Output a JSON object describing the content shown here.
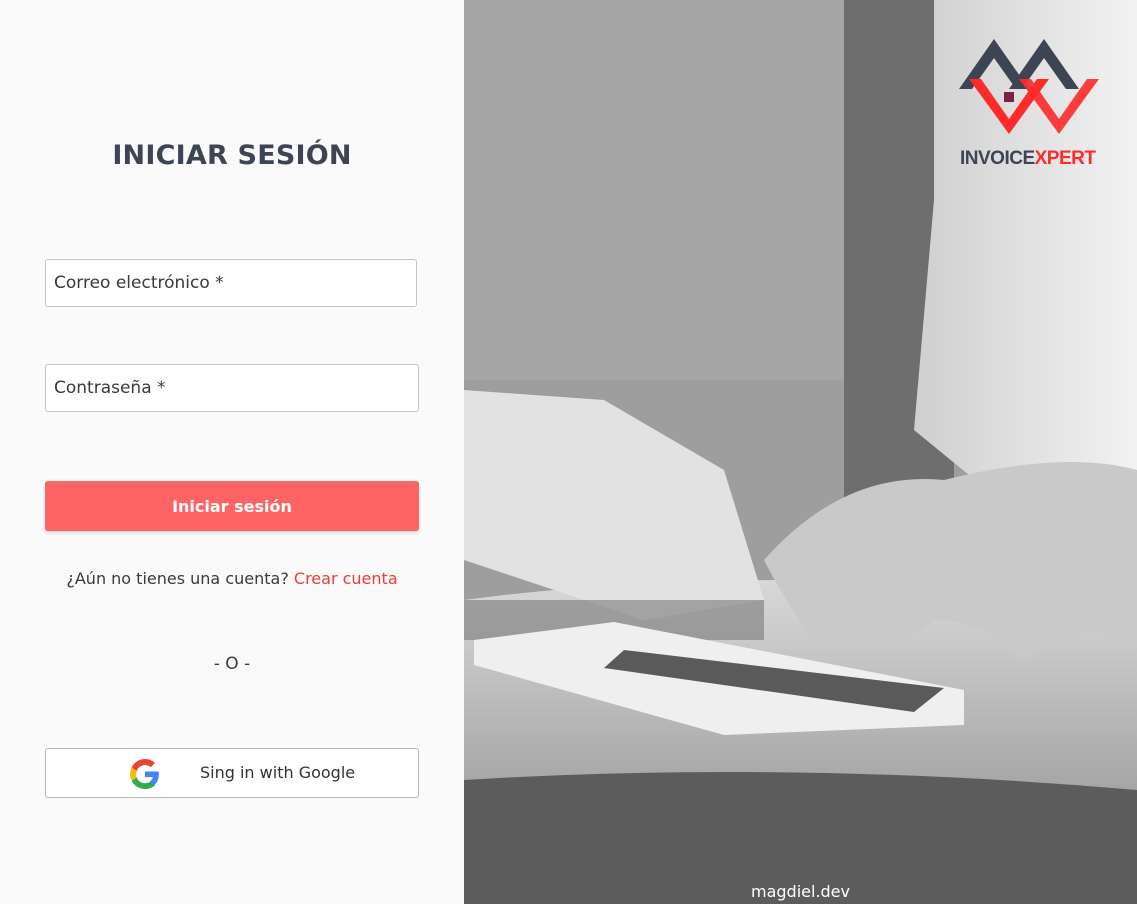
{
  "login": {
    "title": "INICIAR SESIÓN",
    "email_label": "Correo electrónico *",
    "password_label": "Contraseña *",
    "submit_label": "Iniciar sesión",
    "signup_prompt": "¿Aún no tienes una cuenta?",
    "signup_link": "Crear cuenta",
    "separator": "- O -",
    "google_label": "Sing in with Google"
  },
  "brand": {
    "name_part1": "INVOICE",
    "name_part2": "XPERT",
    "dark_color": "#3d4454",
    "accent_color": "#ff2a2a"
  },
  "footer": {
    "text": "magdiel.dev"
  },
  "colors": {
    "primary_button": "#ff6464",
    "link": "#f03a3a",
    "heading": "#3d4454"
  }
}
